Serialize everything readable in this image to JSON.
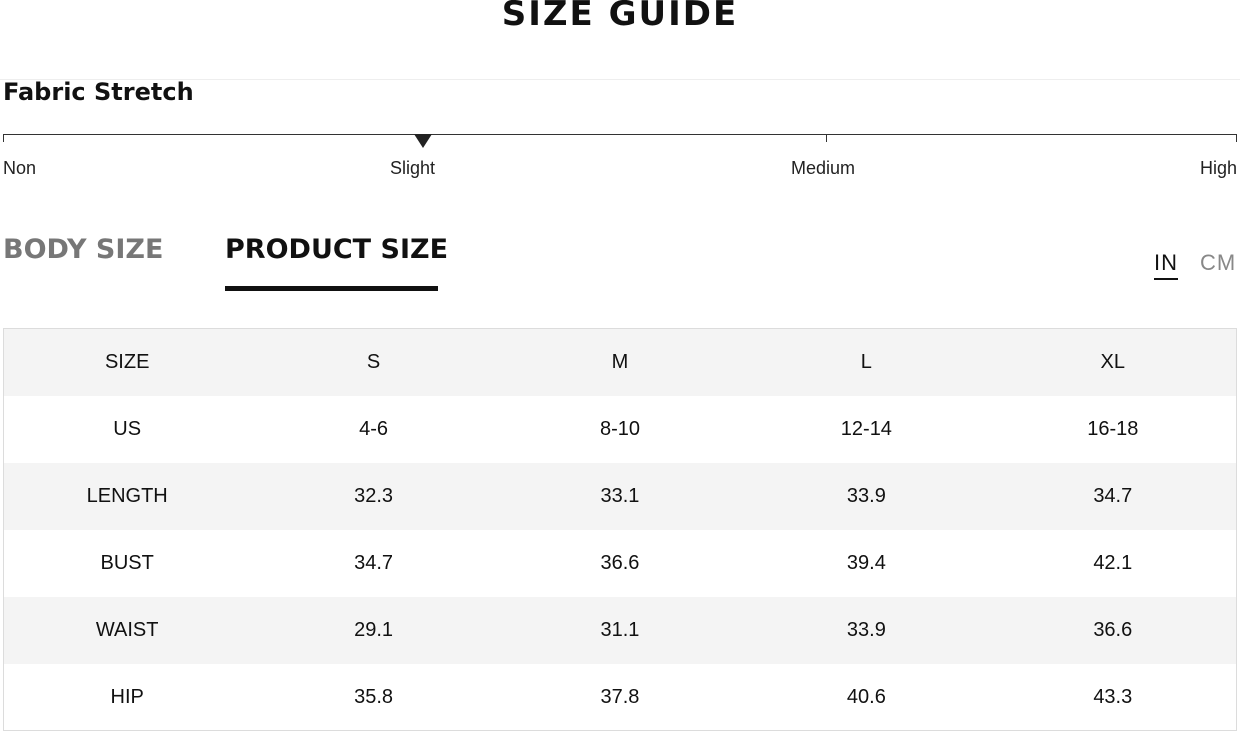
{
  "page": {
    "title": "SIZE GUIDE"
  },
  "fabric_stretch": {
    "heading": "Fabric Stretch",
    "levels": [
      "Non",
      "Slight",
      "Medium",
      "High"
    ],
    "selected": "Slight"
  },
  "tabs": [
    {
      "label": "BODY SIZE",
      "active": false
    },
    {
      "label": "PRODUCT SIZE",
      "active": true
    }
  ],
  "units": {
    "options": [
      "IN",
      "CM"
    ],
    "selected": "IN"
  },
  "size_table": {
    "header": [
      "SIZE",
      "S",
      "M",
      "L",
      "XL"
    ],
    "rows": [
      [
        "US",
        "4-6",
        "8-10",
        "12-14",
        "16-18"
      ],
      [
        "LENGTH",
        "32.3",
        "33.1",
        "33.9",
        "34.7"
      ],
      [
        "BUST",
        "34.7",
        "36.6",
        "39.4",
        "42.1"
      ],
      [
        "WAIST",
        "29.1",
        "31.1",
        "33.9",
        "36.6"
      ],
      [
        "HIP",
        "35.8",
        "37.8",
        "40.6",
        "43.3"
      ]
    ]
  }
}
